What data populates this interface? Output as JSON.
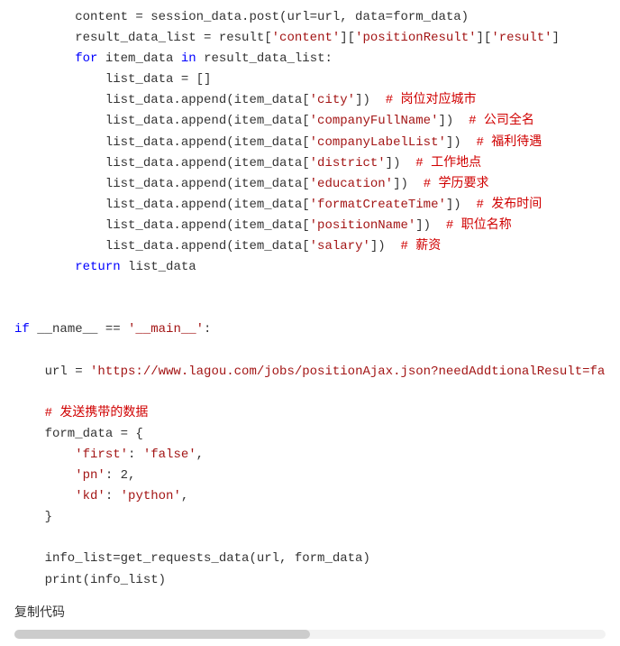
{
  "lines": [
    {
      "indent": 2,
      "spans": [
        {
          "t": "content = session_data.post(url=url, data=form_data)"
        }
      ]
    },
    {
      "indent": 2,
      "spans": [
        {
          "t": "result_data_list = result["
        },
        {
          "t": "'content'",
          "c": "str"
        },
        {
          "t": "]["
        },
        {
          "t": "'positionResult'",
          "c": "str"
        },
        {
          "t": "]["
        },
        {
          "t": "'result'",
          "c": "str"
        },
        {
          "t": "]"
        }
      ]
    },
    {
      "indent": 2,
      "spans": [
        {
          "t": "for",
          "c": "kw"
        },
        {
          "t": " item_data "
        },
        {
          "t": "in",
          "c": "kw"
        },
        {
          "t": " result_data_list:"
        }
      ]
    },
    {
      "indent": 3,
      "spans": [
        {
          "t": "list_data = []"
        }
      ]
    },
    {
      "indent": 3,
      "spans": [
        {
          "t": "list_data.append(item_data["
        },
        {
          "t": "'city'",
          "c": "str"
        },
        {
          "t": "])  "
        },
        {
          "t": "# 岗位对应城市",
          "c": "cmt"
        }
      ]
    },
    {
      "indent": 3,
      "spans": [
        {
          "t": "list_data.append(item_data["
        },
        {
          "t": "'companyFullName'",
          "c": "str"
        },
        {
          "t": "])  "
        },
        {
          "t": "# 公司全名",
          "c": "cmt"
        }
      ]
    },
    {
      "indent": 3,
      "spans": [
        {
          "t": "list_data.append(item_data["
        },
        {
          "t": "'companyLabelList'",
          "c": "str"
        },
        {
          "t": "])  "
        },
        {
          "t": "# 福利待遇",
          "c": "cmt"
        }
      ]
    },
    {
      "indent": 3,
      "spans": [
        {
          "t": "list_data.append(item_data["
        },
        {
          "t": "'district'",
          "c": "str"
        },
        {
          "t": "])  "
        },
        {
          "t": "# 工作地点",
          "c": "cmt"
        }
      ]
    },
    {
      "indent": 3,
      "spans": [
        {
          "t": "list_data.append(item_data["
        },
        {
          "t": "'education'",
          "c": "str"
        },
        {
          "t": "])  "
        },
        {
          "t": "# 学历要求",
          "c": "cmt"
        }
      ]
    },
    {
      "indent": 3,
      "spans": [
        {
          "t": "list_data.append(item_data["
        },
        {
          "t": "'formatCreateTime'",
          "c": "str"
        },
        {
          "t": "])  "
        },
        {
          "t": "# 发布时间",
          "c": "cmt"
        }
      ]
    },
    {
      "indent": 3,
      "spans": [
        {
          "t": "list_data.append(item_data["
        },
        {
          "t": "'positionName'",
          "c": "str"
        },
        {
          "t": "])  "
        },
        {
          "t": "# 职位名称",
          "c": "cmt"
        }
      ]
    },
    {
      "indent": 3,
      "spans": [
        {
          "t": "list_data.append(item_data["
        },
        {
          "t": "'salary'",
          "c": "str"
        },
        {
          "t": "])  "
        },
        {
          "t": "# 薪资",
          "c": "cmt"
        }
      ]
    },
    {
      "indent": 2,
      "spans": [
        {
          "t": "return",
          "c": "kw"
        },
        {
          "t": " list_data"
        }
      ]
    },
    {
      "indent": 0,
      "spans": []
    },
    {
      "indent": 0,
      "spans": []
    },
    {
      "indent": 0,
      "spans": [
        {
          "t": "if",
          "c": "kw"
        },
        {
          "t": " __name__ == "
        },
        {
          "t": "'__main__'",
          "c": "str"
        },
        {
          "t": ":"
        }
      ]
    },
    {
      "indent": 0,
      "spans": []
    },
    {
      "indent": 1,
      "spans": [
        {
          "t": "url = "
        },
        {
          "t": "'https://www.lagou.com/jobs/positionAjax.json?needAddtionalResult=false'",
          "c": "str"
        }
      ]
    },
    {
      "indent": 0,
      "spans": []
    },
    {
      "indent": 1,
      "spans": [
        {
          "t": "# 发送携带的数据",
          "c": "cmt"
        }
      ]
    },
    {
      "indent": 1,
      "spans": [
        {
          "t": "form_data = {"
        }
      ]
    },
    {
      "indent": 2,
      "spans": [
        {
          "t": "'first'",
          "c": "dictkey"
        },
        {
          "t": ": "
        },
        {
          "t": "'false'",
          "c": "str"
        },
        {
          "t": ","
        }
      ]
    },
    {
      "indent": 2,
      "spans": [
        {
          "t": "'pn'",
          "c": "dictkey"
        },
        {
          "t": ": 2,"
        }
      ]
    },
    {
      "indent": 2,
      "spans": [
        {
          "t": "'kd'",
          "c": "dictkey"
        },
        {
          "t": ": "
        },
        {
          "t": "'python'",
          "c": "str"
        },
        {
          "t": ","
        }
      ]
    },
    {
      "indent": 1,
      "spans": [
        {
          "t": "}"
        }
      ]
    },
    {
      "indent": 0,
      "spans": []
    },
    {
      "indent": 1,
      "spans": [
        {
          "t": "info_list=get_requests_data(url, form_data)"
        }
      ]
    },
    {
      "indent": 1,
      "spans": [
        {
          "t": "print",
          "c": "builtin"
        },
        {
          "t": "(info_list)"
        }
      ]
    }
  ],
  "copyLabel": "复制代码"
}
